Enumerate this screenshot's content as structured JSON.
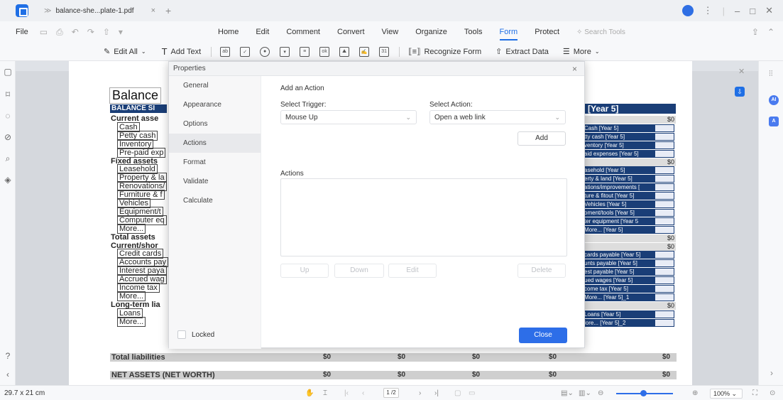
{
  "window": {
    "tab_title": "balance-she...plate-1.pdf",
    "tab_close": "×",
    "new_tab": "+"
  },
  "menu": {
    "file": "File",
    "tabs": [
      "Home",
      "Edit",
      "Comment",
      "Convert",
      "View",
      "Organize",
      "Tools",
      "Form",
      "Protect"
    ],
    "active_tab": "Form",
    "search_placeholder": "Search Tools"
  },
  "toolbar": {
    "edit_all": "Edit All",
    "add_text": "Add Text",
    "recognize_form": "Recognize Form",
    "extract_data": "Extract Data",
    "more": "More"
  },
  "document": {
    "title": "Balance",
    "header_band": "BALANCE SI",
    "year_header": "[Year 5]",
    "left_rows": [
      {
        "text": "Current asse",
        "bold": true
      },
      {
        "text": "Cash",
        "bold": false
      },
      {
        "text": "Petty cash",
        "bold": false
      },
      {
        "text": "Inventory",
        "bold": false
      },
      {
        "text": "Pre-paid exp",
        "bold": false
      },
      {
        "text": "Fixed assets",
        "bold": true
      },
      {
        "text": "Leasehold",
        "bold": false
      },
      {
        "text": "Property & la",
        "bold": false
      },
      {
        "text": "Renovations/",
        "bold": false
      },
      {
        "text": "Furniture & f",
        "bold": false
      },
      {
        "text": "Vehicles",
        "bold": false
      },
      {
        "text": "Equipment/t",
        "bold": false
      },
      {
        "text": "Computer eq",
        "bold": false
      },
      {
        "text": "More...",
        "bold": false
      },
      {
        "text": "Total assets",
        "bold": true
      },
      {
        "text": "Current/shor",
        "bold": true
      },
      {
        "text": "Credit cards",
        "bold": false
      },
      {
        "text": "Accounts pay",
        "bold": false
      },
      {
        "text": "Interest paya",
        "bold": false
      },
      {
        "text": "Accrued wag",
        "bold": false
      },
      {
        "text": "Income tax",
        "bold": false
      },
      {
        "text": "More...",
        "bold": false
      },
      {
        "text": "Long-term lia",
        "bold": true
      },
      {
        "text": "Loans",
        "bold": false
      },
      {
        "text": "More...",
        "bold": false
      },
      {
        "text": "Total liabilities",
        "bold": true
      }
    ],
    "right_fields": [
      "$0",
      "Cash [Year 5]",
      "tty cash [Year 5]",
      "ventory [Year 5]",
      "aid expenses [Year 5]",
      "$0",
      "asehold [Year 5]",
      "erty & land [Year 5]",
      "ations/improvements [",
      "ture & fitout [Year 5]",
      "Vehicles [Year 5]",
      "oment/tools [Year 5]",
      "ter equipment [Year 5",
      "More... [Year 5]",
      "$0",
      "$0",
      "cards payable [Year 5]",
      "unts payable [Year 5]",
      "est payable [Year 5]",
      "ued wages [Year 5]",
      "come tax [Year 5]",
      "More... [Year 5]_1",
      "$0",
      "Loans [Year 5]",
      "lore... [Year 5]_2",
      "$0"
    ],
    "total_liabilities_values": [
      "$0",
      "$0",
      "$0",
      "$0",
      "$0"
    ],
    "net_assets_label": "NET ASSETS (NET WORTH)",
    "net_assets_values": [
      "$0",
      "$0",
      "$0",
      "$0",
      "$0"
    ]
  },
  "dialog": {
    "title": "Properties",
    "close": "×",
    "nav": [
      "General",
      "Appearance",
      "Options",
      "Actions",
      "Format",
      "Validate",
      "Calculate"
    ],
    "active_nav": "Actions",
    "add_action_heading": "Add an Action",
    "select_trigger_label": "Select Trigger:",
    "select_trigger_value": "Mouse Up",
    "select_action_label": "Select Action:",
    "select_action_value": "Open a web link",
    "add_button": "Add",
    "actions_label": "Actions",
    "up_button": "Up",
    "down_button": "Down",
    "edit_button": "Edit",
    "delete_button": "Delete",
    "locked_label": "Locked",
    "close_button": "Close"
  },
  "status": {
    "page_size": "29.7 x 21 cm",
    "page_indicator": "1 /2",
    "zoom": "100%"
  },
  "colors": {
    "accent": "#2d6ee8",
    "form_navy": "#1a3e77"
  }
}
